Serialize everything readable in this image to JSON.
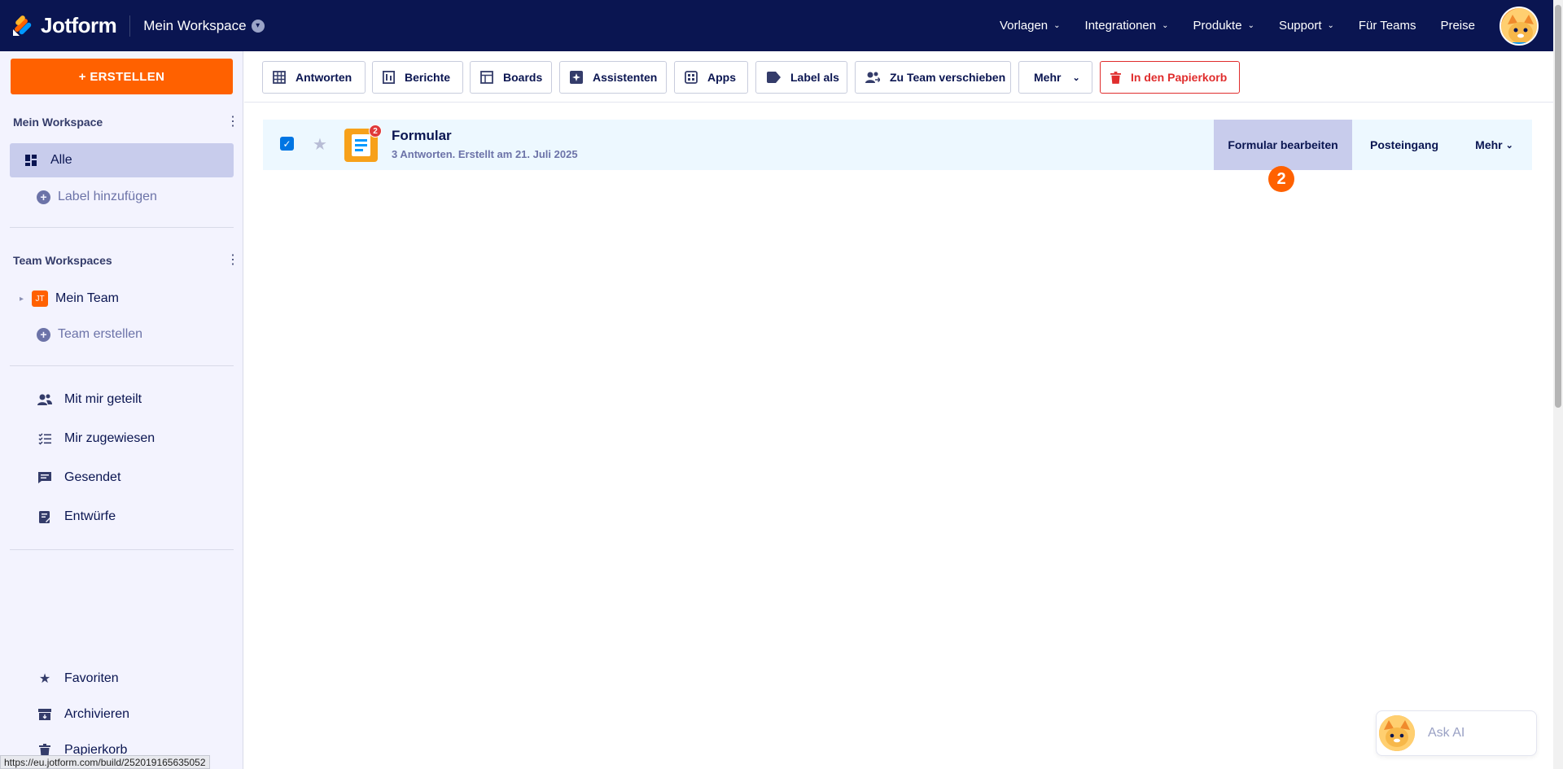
{
  "topbar": {
    "brand": "Jotform",
    "workspace": "Mein Workspace",
    "nav": [
      {
        "label": "Vorlagen",
        "dropdown": true
      },
      {
        "label": "Integrationen",
        "dropdown": true
      },
      {
        "label": "Produkte",
        "dropdown": true
      },
      {
        "label": "Support",
        "dropdown": true
      },
      {
        "label": "Für Teams",
        "dropdown": false
      },
      {
        "label": "Preise",
        "dropdown": false
      }
    ]
  },
  "sidebar": {
    "create_label": "+ ERSTELLEN",
    "my_workspace_heading": "Mein Workspace",
    "all_label": "Alle",
    "add_label": "Label hinzufügen",
    "team_heading": "Team Workspaces",
    "team_name": "Mein Team",
    "create_team": "Team erstellen",
    "items": [
      {
        "label": "Mit mir geteilt",
        "icon": "shared-users-icon"
      },
      {
        "label": "Mir zugewiesen",
        "icon": "checklist-icon"
      },
      {
        "label": "Gesendet",
        "icon": "sent-message-icon"
      },
      {
        "label": "Entwürfe",
        "icon": "draft-icon"
      }
    ],
    "bottom_items": [
      {
        "label": "Favoriten",
        "icon": "star-icon"
      },
      {
        "label": "Archivieren",
        "icon": "archive-icon"
      },
      {
        "label": "Papierkorb",
        "icon": "trash-icon"
      }
    ]
  },
  "toolbar": {
    "buttons": [
      {
        "label": "Antworten",
        "icon": "table-icon"
      },
      {
        "label": "Berichte",
        "icon": "report-icon"
      },
      {
        "label": "Boards",
        "icon": "board-icon"
      },
      {
        "label": "Assistenten",
        "icon": "ai-agent-icon"
      },
      {
        "label": "Apps",
        "icon": "apps-icon"
      },
      {
        "label": "Label als",
        "icon": "label-icon"
      },
      {
        "label": "Zu Team verschieben",
        "icon": "team-move-icon"
      },
      {
        "label": "Mehr",
        "icon": "chevron-down-icon"
      },
      {
        "label": "In den Papierkorb",
        "icon": "trash-icon"
      }
    ]
  },
  "form": {
    "title": "Formular",
    "subtitle": "3 Antworten. Erstellt am 21. Juli 2025",
    "badge_count": "2",
    "edit_label": "Formular bearbeiten",
    "inbox_label": "Posteingang",
    "more_label": "Mehr"
  },
  "step_badge": "2",
  "ask_ai": "Ask AI",
  "status_url": "https://eu.jotform.com/build/252019165635052",
  "colors": {
    "nav_bg": "#0a1551",
    "accent_orange": "#ff6100",
    "selected_row": "#edf8ff",
    "active_sidebar": "#c8ccec",
    "danger": "#e02d2d"
  }
}
